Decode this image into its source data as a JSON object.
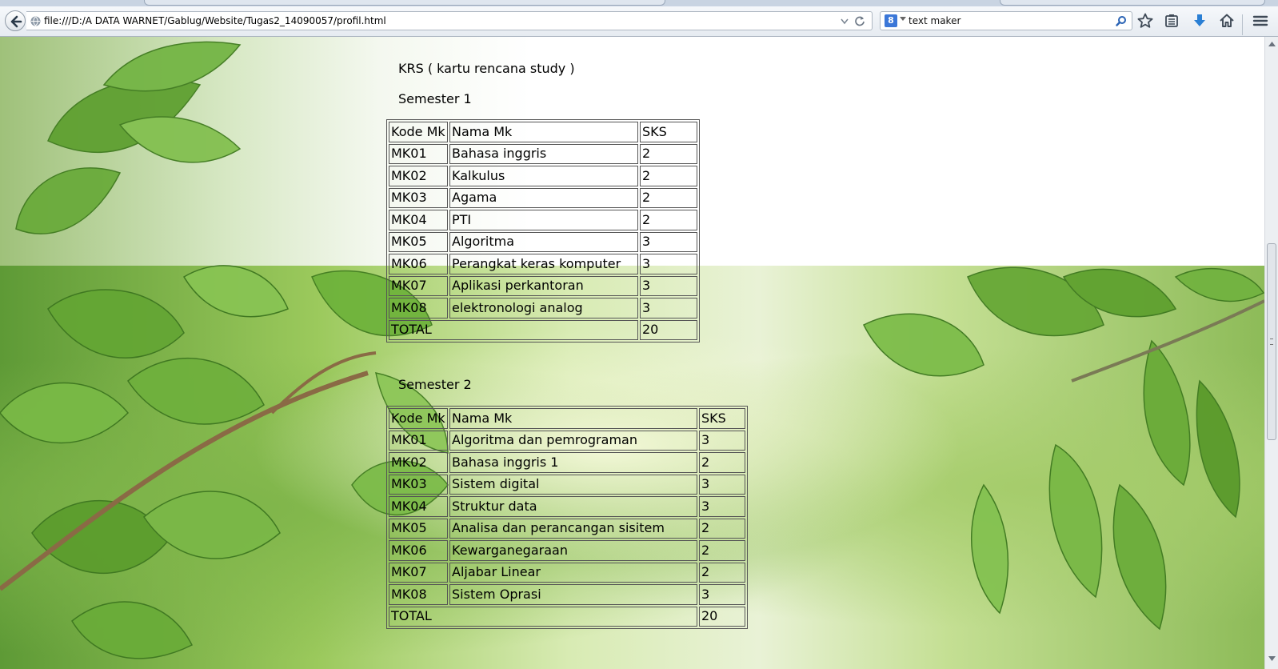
{
  "browser": {
    "url": "file:///D:/A DATA WARNET/Gablug/Website/Tugas2_14090057/profil.html",
    "search_text": "text maker",
    "search_engine_letter": "8"
  },
  "page": {
    "title": "KRS ( kartu rencana study )",
    "semesters": [
      {
        "heading": "Semester 1",
        "headers": [
          "Kode Mk",
          "Nama Mk",
          "SKS"
        ],
        "rows": [
          [
            "MK01",
            "Bahasa inggris",
            "2"
          ],
          [
            "MK02",
            "Kalkulus",
            "2"
          ],
          [
            "MK03",
            "Agama",
            "2"
          ],
          [
            "MK04",
            "PTI",
            "2"
          ],
          [
            "MK05",
            "Algoritma",
            "3"
          ],
          [
            "MK06",
            "Perangkat keras komputer",
            "3"
          ],
          [
            "MK07",
            "Aplikasi perkantoran",
            "3"
          ],
          [
            "MK08",
            "elektronologi analog",
            "3"
          ]
        ],
        "total_label": "TOTAL",
        "total_value": "20"
      },
      {
        "heading": "Semester 2",
        "headers": [
          "Kode Mk",
          "Nama Mk",
          "SKS"
        ],
        "rows": [
          [
            "MK01",
            "Algoritma dan pemrograman",
            "3"
          ],
          [
            "MK02",
            "Bahasa inggris 1",
            "2"
          ],
          [
            "MK03",
            "Sistem digital",
            "3"
          ],
          [
            "MK04",
            "Struktur data",
            "3"
          ],
          [
            "MK05",
            "Analisa dan perancangan sisitem",
            "2"
          ],
          [
            "MK06",
            "Kewarganegaraan",
            "2"
          ],
          [
            "MK07",
            "Aljabar Linear",
            "2"
          ],
          [
            "MK08",
            "Sistem Oprasi",
            "3"
          ]
        ],
        "total_label": "TOTAL",
        "total_value": "20"
      }
    ]
  },
  "colors": {
    "chrome_bg": "#e6ebf1",
    "leaf_green": "#6aa83a",
    "download_blue": "#2a7fd4"
  },
  "icons": [
    "back-arrow-icon",
    "site-identity-icon",
    "dropmarker-icon",
    "reload-icon",
    "search-engine-icon",
    "search-go-icon",
    "bookmark-star-icon",
    "reading-list-icon",
    "download-icon",
    "home-icon",
    "menu-icon"
  ]
}
